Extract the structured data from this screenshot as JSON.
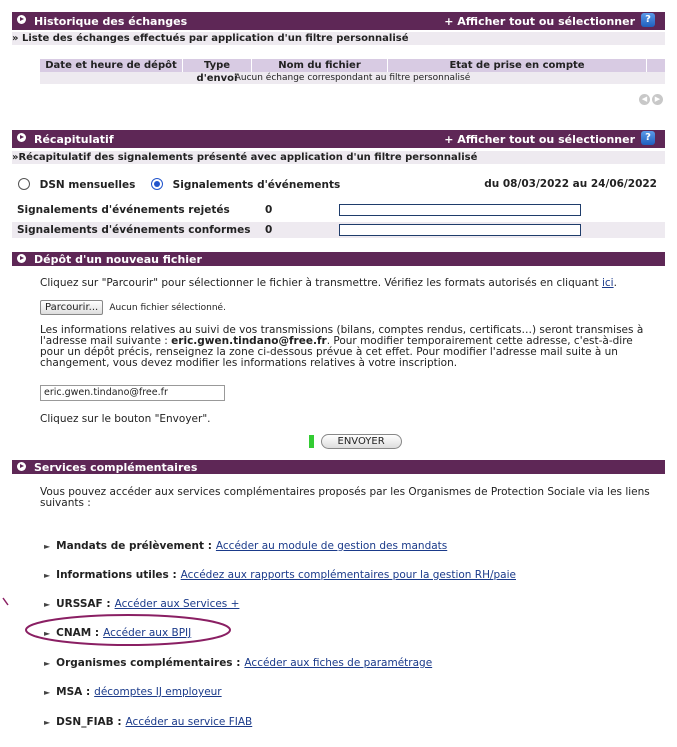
{
  "historique": {
    "title": "Historique des échanges",
    "action": "+ Afficher tout ou sélectionner",
    "help": "?",
    "subtitle": "» Liste des échanges effectués par application d'un filtre personnalisé",
    "columns": [
      "Date et heure de dépôt",
      "Type d'envoi",
      "Nom du fichier",
      "Etat de prise en compte"
    ],
    "empty_message": "Aucun échange correspondant au filtre personnalisé"
  },
  "recap": {
    "title": "Récapitulatif",
    "action": "+ Afficher tout ou sélectionner",
    "help": "?",
    "subtitle": "»Récapitulatif des signalements présenté avec application d'un filtre personnalisé",
    "radio1": "DSN mensuelles",
    "radio2": "Signalements d'événements",
    "period": "du 08/03/2022 au 24/06/2022",
    "rows": [
      {
        "label": "Signalements d'événements rejetés",
        "value": "0"
      },
      {
        "label": "Signalements d'événements conformes",
        "value": "0"
      }
    ]
  },
  "depot": {
    "title": "Dépôt d'un nouveau fichier",
    "instruction_pre": "Cliquez sur \"Parcourir\" pour sélectionner le fichier à transmettre. Vérifiez les formats autorisés en cliquant",
    "instruction_link": "ici",
    "browse_label": "Parcourir...",
    "no_file": "Aucun fichier sélectionné.",
    "info_pre": "Les informations relatives au suivi de vos transmissions (bilans, comptes rendus, certificats…) seront transmises à l'adresse mail suivante :",
    "info_email": "eric.gwen.tindano@free.fr",
    "info_post": ". Pour modifier temporairement cette adresse, c'est-à-dire pour un dépôt précis, renseignez la zone ci-dessous prévue à cet effet. Pour modifier l'adresse mail suite à un changement, vous devez modifier les informations relatives à votre inscription.",
    "email_value": "eric.gwen.tindano@free.fr",
    "send_instruction": "Cliquez sur le bouton \"Envoyer\".",
    "send_label": "ENVOYER"
  },
  "services": {
    "title": "Services complémentaires",
    "intro": "Vous pouvez accéder aux services complémentaires proposés par les Organismes de Protection Sociale via les liens suivants :",
    "items": [
      {
        "label": "Mandats de prélèvement :",
        "link": "Accéder au module de gestion des mandats"
      },
      {
        "label": "Informations utiles :",
        "link": "Accédez aux rapports complémentaires pour la gestion RH/paie"
      },
      {
        "label": "URSSAF :",
        "link": "Accéder aux Services +"
      },
      {
        "label": "CNAM :",
        "link": "Accéder aux BPIJ"
      },
      {
        "label": "Organismes complémentaires :",
        "link": "Accéder aux fiches de paramétrage"
      },
      {
        "label": "MSA :",
        "link": "décomptes IJ employeur"
      },
      {
        "label": "DSN_FIAB :",
        "link": "Accéder au service FIAB"
      }
    ]
  },
  "colors": {
    "header": "#5e2756",
    "highlight": "#8a1f63",
    "link": "#1a3a8a"
  }
}
